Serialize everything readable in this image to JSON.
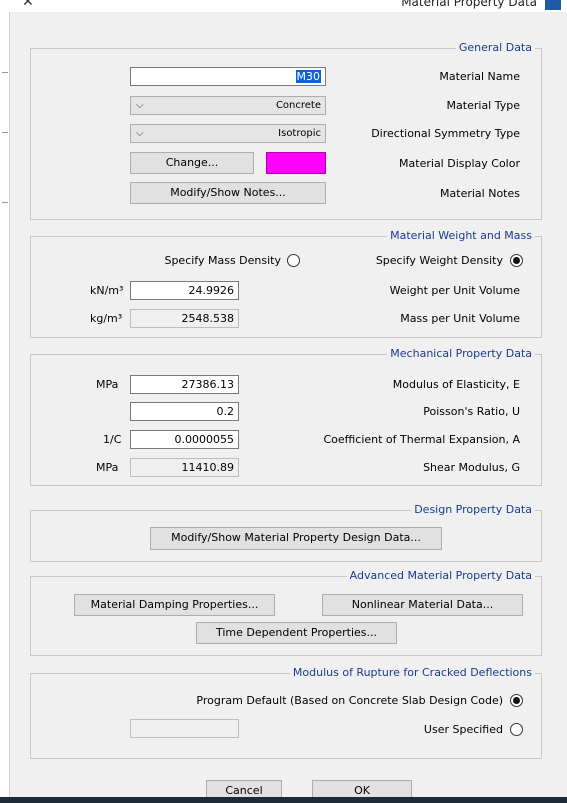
{
  "window": {
    "title": "Material Property Data",
    "close_glyph": "✕"
  },
  "general": {
    "legend": "General Data",
    "material_name_label": "Material Name",
    "material_name_value": "M30",
    "material_type_label": "Material Type",
    "material_type_value": "Concrete",
    "symmetry_label": "Directional Symmetry Type",
    "symmetry_value": "Isotropic",
    "display_color_label": "Material Display Color",
    "display_color": "#ff00ff",
    "change_button": "Change...",
    "notes_label": "Material Notes",
    "notes_button": "Modify/Show Notes..."
  },
  "weight_mass": {
    "legend": "Material Weight and Mass",
    "specify_weight_label": "Specify Weight Density",
    "specify_mass_label": "Specify Mass Density",
    "selected": "weight",
    "weight_label": "Weight per Unit Volume",
    "weight_value": "24.9926",
    "weight_unit": "kN/m³",
    "mass_label": "Mass per Unit Volume",
    "mass_value": "2548.538",
    "mass_unit": "kg/m³"
  },
  "mechanical": {
    "legend": "Mechanical Property Data",
    "elasticity_label": "Modulus of Elasticity,  E",
    "elasticity_value": "27386.13",
    "elasticity_unit": "MPa",
    "poisson_label": "Poisson's Ratio,  U",
    "poisson_value": "0.2",
    "thermal_label": "Coefficient of Thermal Expansion,  A",
    "thermal_value": "0.0000055",
    "thermal_unit": "1/C",
    "shear_label": "Shear Modulus,  G",
    "shear_value": "11410.89",
    "shear_unit": "MPa"
  },
  "design": {
    "legend": "Design Property Data",
    "button": "Modify/Show Material Property Design Data..."
  },
  "advanced": {
    "legend": "Advanced Material Property Data",
    "nonlinear_button": "Nonlinear Material Data...",
    "damping_button": "Material Damping Properties...",
    "time_button": "Time Dependent Properties..."
  },
  "rupture": {
    "legend": "Modulus of Rupture for Cracked Deflections",
    "program_default_label": "Program Default  (Based on Concrete Slab Design Code)",
    "user_specified_label": "User Specified",
    "selected": "program_default",
    "user_value": ""
  },
  "footer": {
    "ok": "OK",
    "cancel": "Cancel"
  }
}
